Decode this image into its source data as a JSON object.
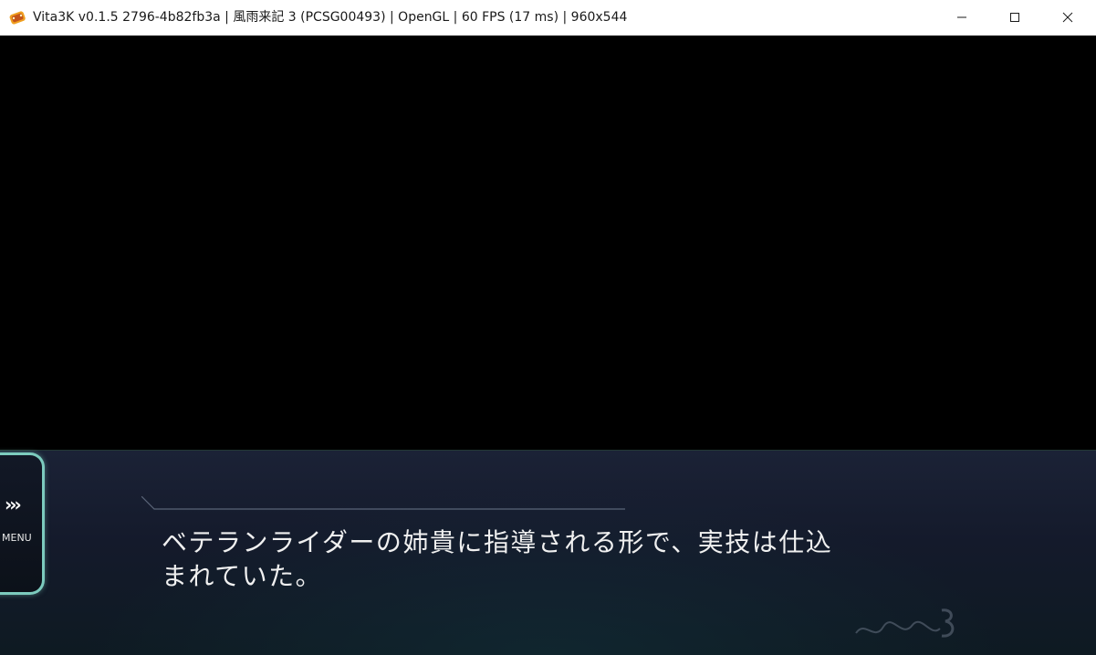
{
  "window": {
    "title": "Vita3K v0.1.5 2796-4b82fb3a | 風雨来記 3  (PCSG00493) | OpenGL | 60 FPS (17 ms) | 960x544",
    "icon": "vita3k-app-icon",
    "controls": {
      "minimize": "minimize-icon",
      "maximize": "maximize-icon",
      "close": "close-icon"
    }
  },
  "game": {
    "menu": {
      "arrows": "›››",
      "label": "MENU"
    },
    "dialogue": {
      "line1": "ベテランライダーの姉貴に指導される形で、実技は仕込",
      "line2": "まれていた。"
    },
    "logo": "風雨来記3"
  },
  "colors": {
    "accent": "#7ccbbe",
    "panel": "#141a2b",
    "text": "#f0f0f0"
  }
}
